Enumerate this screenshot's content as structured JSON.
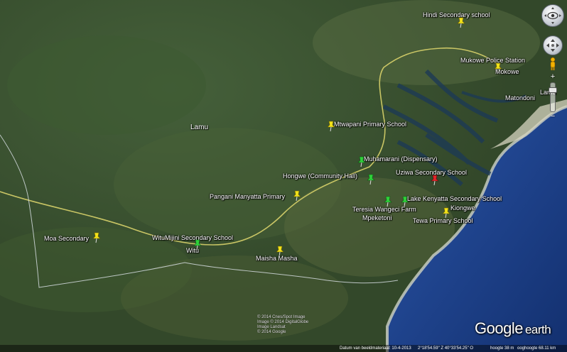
{
  "map": {
    "colors": {
      "land": "#3b4e2a",
      "sea": "#1c3e8c",
      "coast": "#cfd3c4",
      "road": "#d8d26a",
      "boundary": "#dde3ea",
      "pin_yellow": "#f2e21a",
      "pin_green": "#2fd13a",
      "pin_red": "#e5242a"
    },
    "region_label": "Lamu",
    "places": [
      {
        "id": "hindi",
        "label": "Hindi Secondary school",
        "pin": "yellow"
      },
      {
        "id": "mukowe-police",
        "label": "Mukowe Police Station",
        "pin": "yellow"
      },
      {
        "id": "mokowe",
        "label": "Mokowe",
        "pin": "none"
      },
      {
        "id": "matondoni",
        "label": "Matondoni",
        "pin": "none"
      },
      {
        "id": "lamu-town",
        "label": "Lamu",
        "pin": "none"
      },
      {
        "id": "mtwapani",
        "label": "Mtwapani Primary School",
        "pin": "yellow"
      },
      {
        "id": "muhamarani",
        "label": "Muhamarani (Dispensary)",
        "pin": "green"
      },
      {
        "id": "hongwe",
        "label": "Hongwe (Community Hall)",
        "pin": "green"
      },
      {
        "id": "uziwa",
        "label": "Uziwa Secondary School",
        "pin": "red"
      },
      {
        "id": "lake-kenyatta",
        "label": "Lake Kenyatta Secondary School",
        "pin": "green"
      },
      {
        "id": "kiongwe",
        "label": "Kiongwe",
        "pin": "yellow"
      },
      {
        "id": "teresia",
        "label": "Teresia Wangeci Farm",
        "pin": "green"
      },
      {
        "id": "mpeketoni",
        "label": "Mpeketoni",
        "pin": "none"
      },
      {
        "id": "tewa",
        "label": "Tewa Primary School",
        "pin": "none"
      },
      {
        "id": "pangani",
        "label": "Pangani Manyatta Primary",
        "pin": "yellow"
      },
      {
        "id": "moa",
        "label": "Moa Secondary",
        "pin": "yellow"
      },
      {
        "id": "witumijini",
        "label": "WituMijini Secondary School",
        "pin": "green"
      },
      {
        "id": "witu",
        "label": "Witu",
        "pin": "none"
      },
      {
        "id": "maisha-masha",
        "label": "Maisha Masha",
        "pin": "yellow"
      }
    ]
  },
  "brand": {
    "google": "Google",
    "earth": "earth"
  },
  "credits": {
    "line1": "© 2014 Cnes/Spot Image",
    "line2": "Image © 2014 DigitalGlobe",
    "line3": "Image Landsat",
    "line4": "© 2014 Google"
  },
  "status": {
    "date": "Datum van beeldmateriaal: 10-4-2013",
    "coords": "2°18'54.59\" Z   40°33'54.25\" O",
    "elev": "hoogte  38 m",
    "eye": "ooghoogte  68.11 km"
  },
  "controls": {
    "look_icon": "eye-icon",
    "move_icon": "arrows-icon",
    "street_icon": "pegman-icon",
    "zoom_in": "+",
    "zoom_out": "−"
  }
}
